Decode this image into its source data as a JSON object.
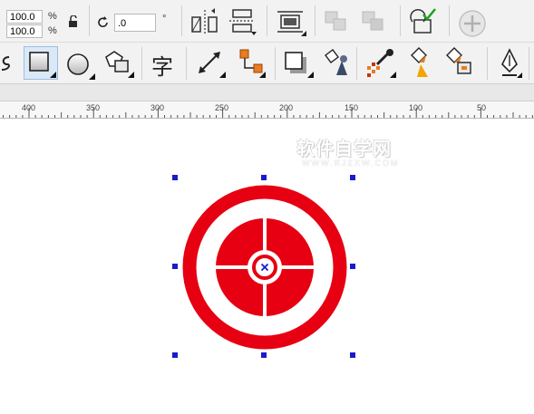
{
  "property_bar": {
    "scale_x": "100.0",
    "scale_y": "100.0",
    "percent_x": "%",
    "percent_y": "%",
    "rotation": ".0",
    "degree": "°"
  },
  "ruler": {
    "labels": [
      "400",
      "350",
      "300",
      "250",
      "200",
      "150",
      "100",
      "50"
    ]
  },
  "watermark": {
    "cn": "软件自学网",
    "en": "WWW.RJZXW.COM"
  },
  "colors": {
    "accent_red": "#e60012",
    "handle_blue": "#1a1acc"
  }
}
